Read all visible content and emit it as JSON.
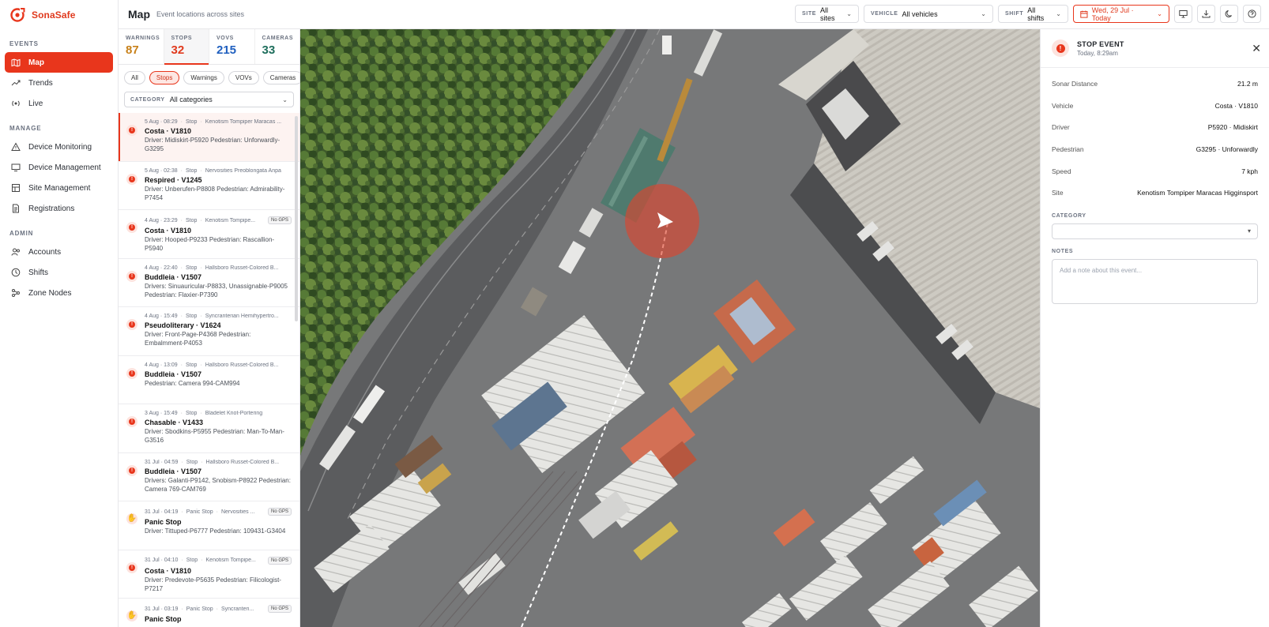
{
  "app": {
    "name": "SonaSafe"
  },
  "header": {
    "title": "Map",
    "subtitle": "Event locations across sites"
  },
  "sidebar": {
    "sections": [
      {
        "title": "EVENTS",
        "items": [
          {
            "label": "Map",
            "icon": "map-icon",
            "active": true
          },
          {
            "label": "Trends",
            "icon": "trends-icon"
          },
          {
            "label": "Live",
            "icon": "live-icon"
          }
        ]
      },
      {
        "title": "MANAGE",
        "items": [
          {
            "label": "Device Monitoring",
            "icon": "warning-icon"
          },
          {
            "label": "Device Management",
            "icon": "device-icon"
          },
          {
            "label": "Site Management",
            "icon": "site-icon"
          },
          {
            "label": "Registrations",
            "icon": "doc-icon"
          }
        ]
      },
      {
        "title": "ADMIN",
        "items": [
          {
            "label": "Accounts",
            "icon": "accounts-icon"
          },
          {
            "label": "Shifts",
            "icon": "clock-icon"
          },
          {
            "label": "Zone Nodes",
            "icon": "nodes-icon"
          }
        ]
      }
    ]
  },
  "filters": {
    "site": {
      "label": "SITE",
      "value": "All sites"
    },
    "vehicle": {
      "label": "VEHICLE",
      "value": "All vehicles"
    },
    "shift": {
      "label": "SHIFT",
      "value": "All shifts"
    },
    "date": {
      "value": "Wed, 29 Jul · Today"
    }
  },
  "stats": [
    {
      "label": "WARNINGS",
      "value": "87",
      "color": "#c8811a"
    },
    {
      "label": "STOPS",
      "value": "32",
      "color": "#e03a1e",
      "active": true
    },
    {
      "label": "VOVS",
      "value": "215",
      "color": "#1f5fbf"
    },
    {
      "label": "CAMERAS",
      "value": "33",
      "color": "#1e6e5c"
    }
  ],
  "type_filters": [
    {
      "label": "All"
    },
    {
      "label": "Stops",
      "active": true
    },
    {
      "label": "Warnings"
    },
    {
      "label": "VOVs"
    },
    {
      "label": "Cameras"
    }
  ],
  "category_filter": {
    "label": "CATEGORY",
    "value": "All categories"
  },
  "events": [
    {
      "time": "5 Aug · 08:29",
      "type": "Stop",
      "site": "Kenotism Tompiper Maracas ...",
      "title": "Costa · V1810",
      "desc": "Driver: Midiskirt-P5920  Pedestrian: Unforwardly-G3295",
      "selected": true,
      "panic": false,
      "no_gps": false
    },
    {
      "time": "5 Aug · 02:38",
      "type": "Stop",
      "site": "Nervosities Preoblongata Anpa",
      "title": "Respired · V1245",
      "desc": "Driver: Unberufen-P8808  Pedestrian: Admirability-P7454",
      "panic": false,
      "no_gps": false
    },
    {
      "time": "4 Aug · 23:29",
      "type": "Stop",
      "site": "Kenotism Tompipe...",
      "title": "Costa · V1810",
      "desc": "Driver: Hooped-P9233  Pedestrian: Rascallion-P5940",
      "panic": false,
      "no_gps": true
    },
    {
      "time": "4 Aug · 22:40",
      "type": "Stop",
      "site": "Hallsboro Russet-Colored B...",
      "title": "Buddleia · V1507",
      "desc": "Drivers: Sinuauricular-P8833, Unassignable-P9005  Pedestrian: Flaxier-P7390",
      "panic": false,
      "no_gps": false
    },
    {
      "time": "4 Aug · 15:49",
      "type": "Stop",
      "site": "Syncranterian Hemihypertro...",
      "title": "Pseudoliterary · V1624",
      "desc": "Driver: Front-Page-P4368  Pedestrian: Embalmment-P4053",
      "panic": false,
      "no_gps": false
    },
    {
      "time": "4 Aug · 13:09",
      "type": "Stop",
      "site": "Hallsboro Russet-Colored B...",
      "title": "Buddleia · V1507",
      "desc": "Pedestrian: Camera 994-CAM994",
      "panic": false,
      "no_gps": false
    },
    {
      "time": "3 Aug · 15:49",
      "type": "Stop",
      "site": "Bladelet Knot-Portering",
      "title": "Chasable · V1433",
      "desc": "Driver: Sbodkins-P5955  Pedestrian: Man-To-Man-G3516",
      "panic": false,
      "no_gps": false
    },
    {
      "time": "31 Jul · 04:59",
      "type": "Stop",
      "site": "Hallsboro Russet-Colored B...",
      "title": "Buddleia · V1507",
      "desc": "Drivers: Galanti-P9142, Snobism-P8922  Pedestrian: Camera 769-CAM769",
      "panic": false,
      "no_gps": false
    },
    {
      "time": "31 Jul · 04:19",
      "type": "Panic Stop",
      "site": "Nervosities ...",
      "title": "Panic Stop",
      "desc": "Driver: Tittuped-P6777  Pedestrian: 109431-G3404",
      "panic": true,
      "no_gps": true
    },
    {
      "time": "31 Jul · 04:10",
      "type": "Stop",
      "site": "Kenotism Tompipe...",
      "title": "Costa · V1810",
      "desc": "Driver: Predevote-P5635  Pedestrian: Filicologist-P7217",
      "panic": false,
      "no_gps": true
    },
    {
      "time": "31 Jul · 03:19",
      "type": "Panic Stop",
      "site": "Syncranteri...",
      "title": "Panic Stop",
      "desc": "",
      "panic": true,
      "no_gps": true
    }
  ],
  "no_gps_label": "No GPS",
  "detail": {
    "title": "STOP EVENT",
    "subtitle": "Today, 8:29am",
    "rows": [
      {
        "key": "Sonar Distance",
        "value": "21.2 m"
      },
      {
        "key": "Vehicle",
        "value": "Costa · V1810"
      },
      {
        "key": "Driver",
        "value": "P5920 · Midiskirt"
      },
      {
        "key": "Pedestrian",
        "value": "G3295 · Unforwardly"
      },
      {
        "key": "Speed",
        "value": "7 kph"
      },
      {
        "key": "Site",
        "value": "Kenotism Tompiper Maracas Higginsport"
      }
    ],
    "category_label": "CATEGORY",
    "notes_label": "NOTES",
    "notes_placeholder": "Add a note about this event..."
  },
  "colors": {
    "accent": "#e8361c"
  }
}
